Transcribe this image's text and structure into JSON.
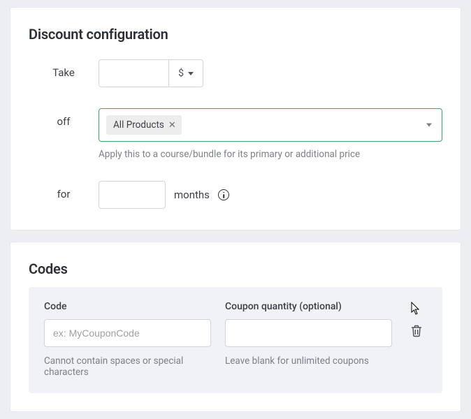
{
  "discount": {
    "title": "Discount configuration",
    "take": {
      "label": "Take",
      "value": "",
      "currency": "$"
    },
    "off": {
      "label": "off",
      "chip": "All Products",
      "helper": "Apply this to a course/bundle for its primary or additional price"
    },
    "for": {
      "label": "for",
      "value": "",
      "unit": "months"
    }
  },
  "codes": {
    "title": "Codes",
    "code": {
      "label": "Code",
      "value": "",
      "placeholder": "ex: MyCouponCode",
      "helper": "Cannot contain spaces or special characters"
    },
    "quantity": {
      "label": "Coupon quantity (optional)",
      "value": "",
      "placeholder": "",
      "helper": "Leave blank for unlimited coupons"
    }
  }
}
